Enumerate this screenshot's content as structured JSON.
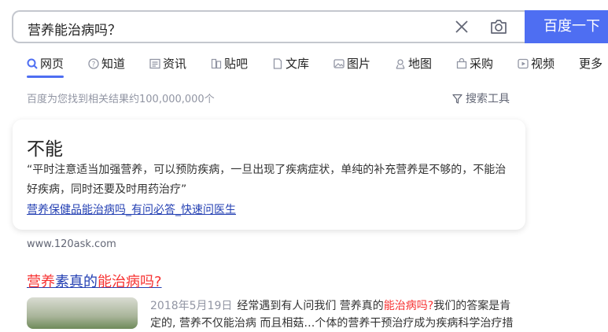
{
  "search": {
    "query": "营养能治病吗？",
    "button_label": "百度一下"
  },
  "tabs": [
    {
      "label": "网页",
      "icon": "search-icon"
    },
    {
      "label": "知道",
      "icon": "question-icon"
    },
    {
      "label": "资讯",
      "icon": "news-icon"
    },
    {
      "label": "贴吧",
      "icon": "tieba-icon"
    },
    {
      "label": "文库",
      "icon": "document-icon"
    },
    {
      "label": "图片",
      "icon": "image-icon"
    },
    {
      "label": "地图",
      "icon": "map-icon"
    },
    {
      "label": "采购",
      "icon": "cart-icon"
    },
    {
      "label": "视频",
      "icon": "video-icon"
    },
    {
      "label": "更多",
      "icon": ""
    }
  ],
  "stats": "百度为您找到相关结果约100,000,000个",
  "tools_label": "搜索工具",
  "answer_card": {
    "answer": "不能",
    "quote": "“平时注意适当加强营养，可以预防疾病，一旦出现了疾病症状，单纯的补充营养是不够的，不能治好疾病，同时还要及时用药治疗”",
    "source_link": "营养保健品能治病吗_有问必答_快速问医生"
  },
  "site": "www.120ask.com",
  "result": {
    "title_part1": "营养",
    "title_part2": "素真的",
    "title_part3": "能治病吗?",
    "date": "2018年5月19日",
    "snippet_a": "经常遇到有人问我们 营养真的",
    "snippet_hl": "能治病吗?",
    "snippet_b": "我们的答案是肯定的, 营养不仅能治病 而且相菇…个体的营养干预治疗成为疾病科学治疗措"
  }
}
